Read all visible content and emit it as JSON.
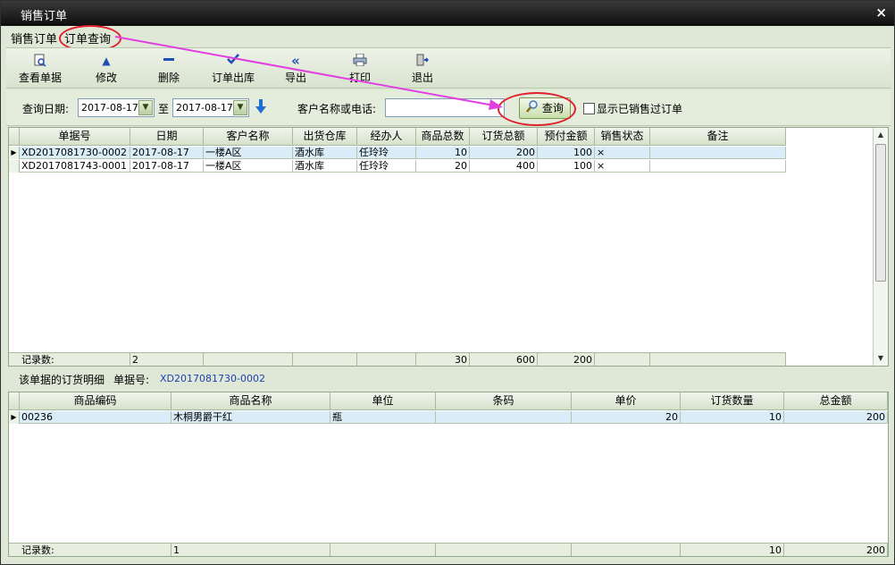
{
  "window": {
    "title": "销售订单",
    "close": "×"
  },
  "tabs": [
    {
      "label": "销售订单"
    },
    {
      "label": "订单查询"
    }
  ],
  "toolbar": {
    "view": "查看单据",
    "edit": "修改",
    "delete": "删除",
    "ship": "订单出库",
    "export": "导出",
    "print": "打印",
    "exit": "退出"
  },
  "filter": {
    "date_label": "查询日期:",
    "date_from": "2017-08-17",
    "to_label": "至",
    "date_to": "2017-08-17",
    "customer_label": "客户名称或电话:",
    "customer_value": "",
    "query_button": "查询",
    "show_sold_label": "显示已销售过订单"
  },
  "orders": {
    "columns": [
      "单据号",
      "日期",
      "客户名称",
      "出货仓库",
      "经办人",
      "商品总数",
      "订货总额",
      "预付金额",
      "销售状态",
      "备注"
    ],
    "rows": [
      [
        "XD2017081730-0002",
        "2017-08-17",
        "一楼A区",
        "酒水库",
        "任玲玲",
        "10",
        "200",
        "100",
        "×",
        ""
      ],
      [
        "XD2017081743-0001",
        "2017-08-17",
        "一楼A区",
        "酒水库",
        "任玲玲",
        "20",
        "400",
        "100",
        "×",
        ""
      ]
    ],
    "footer": {
      "label": "记录数:",
      "count": "2",
      "total_qty": "30",
      "total_amount": "600",
      "total_prepaid": "200"
    }
  },
  "detail": {
    "title": "该单据的订货明细",
    "doc_label": "单据号:",
    "doc_no": "XD2017081730-0002",
    "columns": [
      "商品编码",
      "商品名称",
      "单位",
      "条码",
      "单价",
      "订货数量",
      "总金额"
    ],
    "rows": [
      [
        "00236",
        "木桐男爵干红",
        "瓶",
        "",
        "20",
        "10",
        "200"
      ]
    ],
    "footer": {
      "label": "记录数:",
      "count": "1",
      "total_qty": "10",
      "total_amount": "200"
    }
  },
  "colors": {
    "annotation": "#e0202a",
    "arrow": "#e040e0",
    "accent": "#1d4fb5"
  }
}
